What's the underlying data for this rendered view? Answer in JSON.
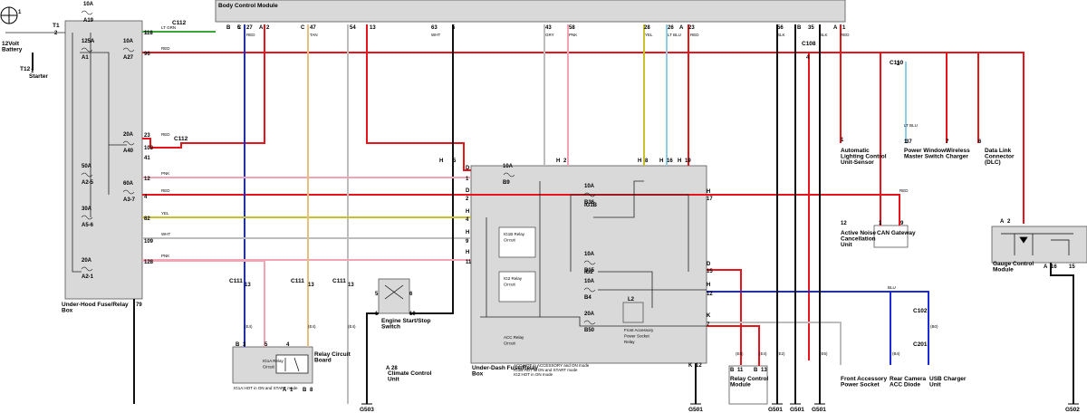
{
  "title": "Body Control Module",
  "components": {
    "battery": "12Volt Battery",
    "starter": "Starter",
    "underhood_box": "Under-Hood Fuse/Relay Box",
    "underdash_box": "Under-Dash Fuse/Relay Box",
    "relay_board": "Relay Circuit Board",
    "ig1a_relay": "IG1A Relay Circuit",
    "engine_switch": "Engine Start/Stop Switch",
    "climate_unit": "Climate Control Unit",
    "ig1b_relay": "IG1B Relay Circuit",
    "ig2_relay": "IG2 Relay Circuit",
    "acc_relay": "ACC Relay Circuit",
    "front_power_relay": "Front Accessory Power Socket Relay",
    "relay_module": "Relay Control Module",
    "front_socket": "Front Accessory Power Socket",
    "rear_camera_diode": "Rear Camera ACC Diode",
    "usb_unit": "USB Charger Unit",
    "lighting_sensor": "Automatic Lighting Control Unit-Sensor",
    "window_switch": "Power Window Master Switch",
    "wireless_charger": "Wireless Charger",
    "dlc": "Data Link Connector (DLC)",
    "noise_unit": "Active Noise Cancellation Unit",
    "can_gateway": "CAN Gateway",
    "gauge_module": "Gauge Control Module"
  },
  "fuses_underhood": [
    {
      "amps": "10A",
      "id": "A19"
    },
    {
      "amps": "125A",
      "id": "A1"
    },
    {
      "amps": "10A",
      "id": "A27"
    },
    {
      "amps": "20A",
      "id": "A40"
    },
    {
      "amps": "50A",
      "id": "A2-5"
    },
    {
      "amps": "60A",
      "id": "A3-7"
    },
    {
      "amps": "30A",
      "id": "A5-6"
    },
    {
      "amps": "20A",
      "id": "A2-1"
    }
  ],
  "fuses_underdash": [
    {
      "amps": "10A",
      "id": "B9"
    },
    {
      "amps": "10A",
      "id": "B36"
    },
    {
      "amps": "10A",
      "id": "B15"
    },
    {
      "amps": "10A",
      "id": "B4"
    },
    {
      "amps": "20A",
      "id": "B50"
    }
  ],
  "inner_labels": {
    "ig1b": "IG1B",
    "ig2": "IG2",
    "l2": "L2"
  },
  "connectors": {
    "c112a": "C112",
    "c112b": "C112",
    "c108": "C108",
    "c110": "C110",
    "c111a": "C111",
    "c111b": "C111",
    "c111c": "C111",
    "c102": "C102",
    "c201": "C201",
    "t1": "T1",
    "t12": "T12"
  },
  "grounds": [
    "G503",
    "G501",
    "G501",
    "G501",
    "G501",
    "G502"
  ],
  "notes": {
    "ig1a_note": "IG1A:HOT in ON and START mode",
    "udash_note1": "ACC:HOT in ACCESSORY and ON mode",
    "udash_note2": "IG1B:HOT in ON and START mode",
    "udash_note3": "IG2:HOT in ON mode"
  },
  "wire_colors": {
    "red": "#e8141b",
    "blue": "#1b2bd6",
    "white": "#bdbdbd",
    "black": "#111111",
    "yellow": "#c9c12b",
    "pink": "#f2a3b4",
    "green": "#3aa63a",
    "tan": "#e9bf7d",
    "lt_blu": "#8fcde8"
  },
  "wire_labels": {
    "red": "RED",
    "blu": "BLU",
    "wht": "WHT",
    "blk": "BLK",
    "yel": "YEL",
    "pnk": "PNK",
    "tan": "TAN",
    "gry": "GRY",
    "ltgrn": "LT GRN",
    "ltblu": "LT BLU",
    "red_blu": "RED BLU",
    "e4": "(E4)",
    "e8": "(E8)",
    "e2": "(E2)",
    "e6": "(E6)",
    "b4": "(B4)",
    "b0": "(B0)"
  },
  "pins": {
    "bcm": [
      "B",
      "5",
      "C",
      "27",
      "A",
      "2",
      "C",
      "47",
      "54",
      "13",
      "63",
      "5",
      "43",
      "58",
      "28",
      "26",
      "A",
      "23",
      "56",
      "B",
      "35",
      "A",
      "1"
    ],
    "uh_left": [
      "1",
      "118",
      "96",
      "23",
      "103",
      "41",
      "12",
      "4",
      "82",
      "109",
      "128",
      "79"
    ],
    "ud": [
      "D",
      "1",
      "D",
      "2",
      "H",
      "4",
      "H",
      "9",
      "H",
      "11",
      "H",
      "17",
      "D",
      "15",
      "H",
      "12",
      "K",
      "7",
      "K",
      "12",
      "H",
      "8",
      "H",
      "16",
      "H",
      "19",
      "H",
      "2",
      "H",
      "5"
    ],
    "misc": [
      "1",
      "4",
      "1",
      "37",
      "7",
      "6",
      "12",
      "1",
      "9",
      "A",
      "2",
      "A",
      "16",
      "15",
      "B",
      "3",
      "5",
      "4",
      "A",
      "1",
      "B",
      "8",
      "13",
      "13",
      "13",
      "5",
      "6",
      "1",
      "10",
      "A",
      "28",
      "B",
      "11",
      "B",
      "13",
      "2",
      "1",
      "2",
      "1"
    ]
  }
}
